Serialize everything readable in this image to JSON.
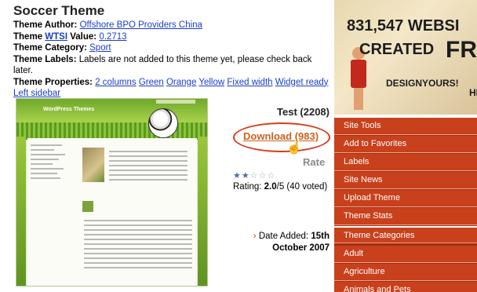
{
  "theme": {
    "title": "Soccer Theme",
    "author_label": "Theme Author:",
    "author_value": "Offshore BPO Providers China",
    "wtsi_prefix": "Theme",
    "wtsi_link": "WTSI",
    "wtsi_suffix": "Value:",
    "wtsi_value": "0.2713",
    "category_label": "Theme Category:",
    "category_value": "Sport",
    "labels_label": "Theme Labels:",
    "labels_value": "Labels are not added to this theme yet, please check back later.",
    "properties_label": "Theme Properties:",
    "properties": [
      "2 columns",
      "Green",
      "Orange",
      "Yellow",
      "Fixed width",
      "Widget ready",
      "Left sidebar"
    ]
  },
  "thumbnail": {
    "brand": "WordPress Themes"
  },
  "stats": {
    "test": "Test (2208)",
    "download": "Download (983)",
    "rate": "Rate",
    "rating_prefix": "Rating: ",
    "rating_value": "2.0",
    "rating_suffix": "/5 (40 voted)",
    "stars_filled": 2,
    "stars_total": 5,
    "date_label": "Date Added:",
    "date_value_day": "15th",
    "date_value_rest": "October 2007"
  },
  "banner": {
    "count": "831,547 WEBSI",
    "created": "CREATED",
    "free": "FRE",
    "design": "DESIGNYOURS!",
    "here": "HER"
  },
  "menu": {
    "items": [
      "Site Tools",
      "Add to Favorites",
      "Labels",
      "Site News",
      "Upload Theme",
      "Theme Stats",
      "Theme Categories",
      "Adult",
      "Agriculture",
      "Animals and Pets"
    ]
  },
  "colors": {
    "link": "#1a3ec8",
    "download": "#c8621e",
    "circle": "#d93a1c",
    "menu_bg": "#c8401c"
  }
}
